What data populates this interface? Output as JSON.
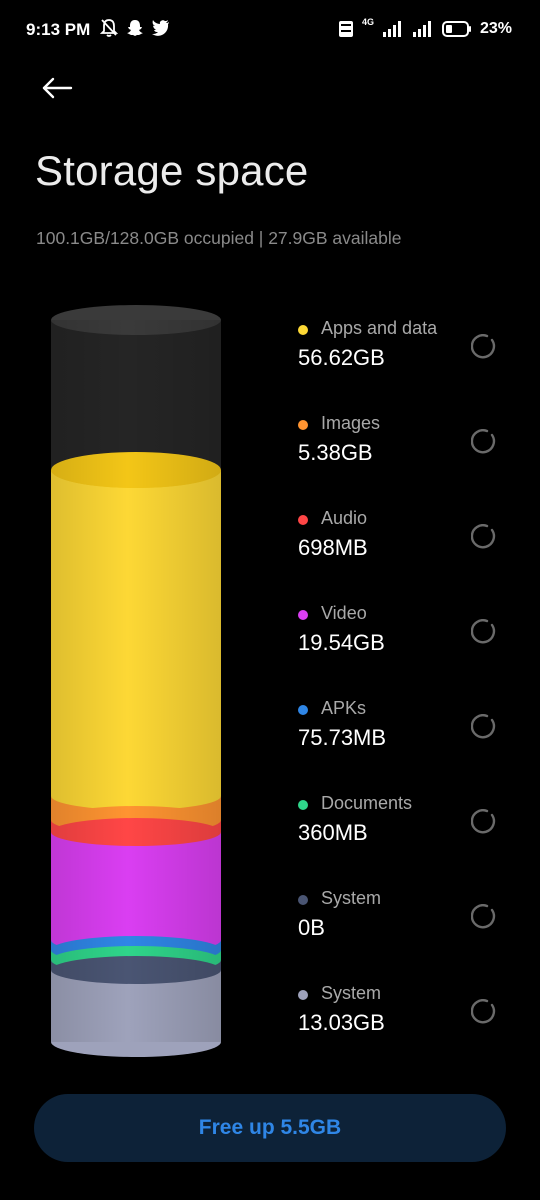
{
  "status_bar": {
    "time": "9:13 PM",
    "icons_left": [
      "bell-off-icon",
      "snapchat-icon",
      "twitter-icon"
    ],
    "icons_right": [
      "volte-icon",
      "4g-signal-icon",
      "wifi-signal-icon",
      "battery-icon"
    ],
    "network": "4G",
    "battery": "23%"
  },
  "header": {
    "back_icon": "arrow-left-icon",
    "title": "Storage space",
    "summary": "100.1GB/128.0GB occupied | 27.9GB available"
  },
  "categories": [
    {
      "name": "Apps and data",
      "value": "56.62GB",
      "color": "#fdd835"
    },
    {
      "name": "Images",
      "value": "5.38GB",
      "color": "#ff9431"
    },
    {
      "name": "Audio",
      "value": "698MB",
      "color": "#ff4646"
    },
    {
      "name": "Video",
      "value": "19.54GB",
      "color": "#da3ef2"
    },
    {
      "name": "APKs",
      "value": "75.73MB",
      "color": "#2f86e6"
    },
    {
      "name": "Documents",
      "value": "360MB",
      "color": "#2fd58a"
    },
    {
      "name": "System",
      "value": "0B",
      "color": "#4a5573"
    },
    {
      "name": "System",
      "value": "13.03GB",
      "color": "#9ea2bb"
    }
  ],
  "free_button": {
    "label": "Free up 5.5GB",
    "color": "#2f86e6"
  }
}
